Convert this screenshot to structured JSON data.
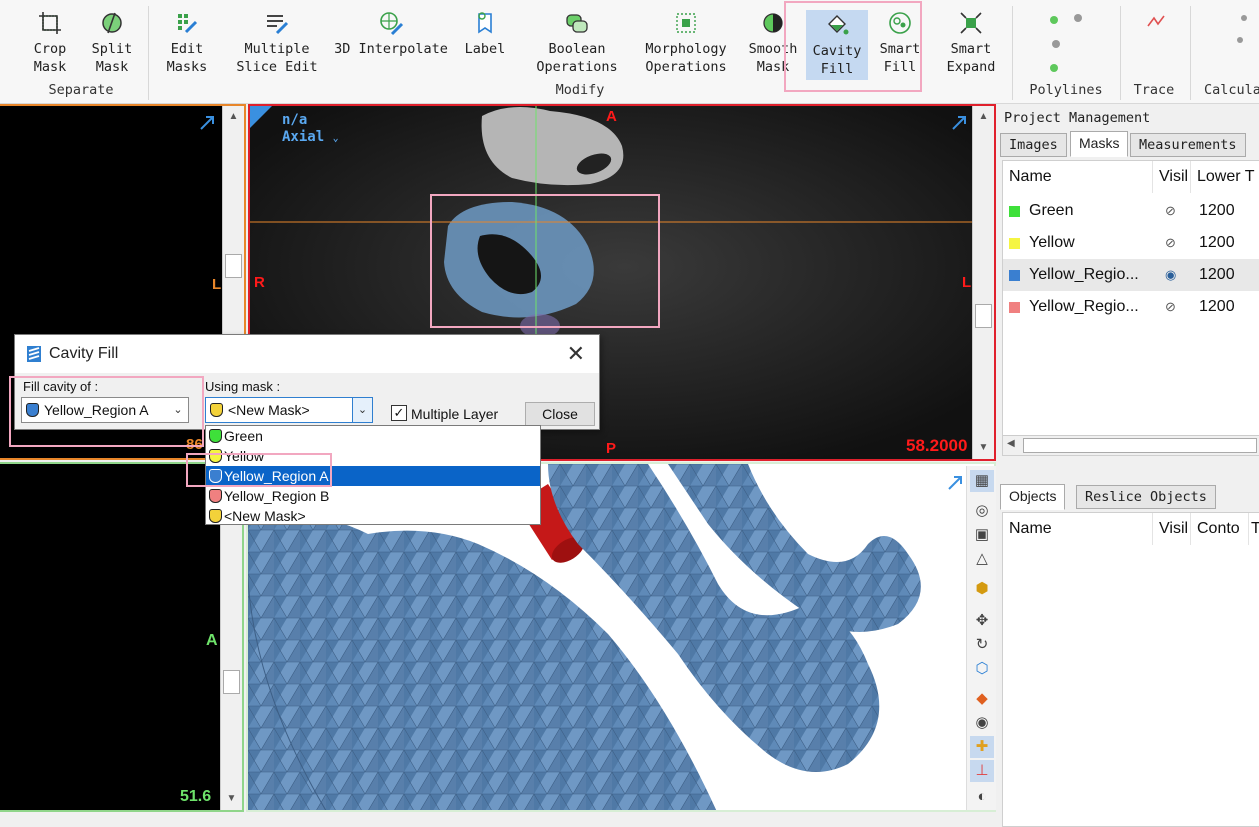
{
  "ribbon": {
    "buttons": [
      {
        "label": "Crop\nMask"
      },
      {
        "label": "Split\nMask"
      },
      {
        "label": "Edit\nMasks"
      },
      {
        "label": "Multiple\nSlice Edit"
      },
      {
        "label": "3D Interpolate"
      },
      {
        "label": "Label"
      },
      {
        "label": "Boolean\nOperations"
      },
      {
        "label": "Morphology\nOperations"
      },
      {
        "label": "Smooth\nMask"
      },
      {
        "label": "Cavity\nFill"
      },
      {
        "label": "Smart\nFill"
      },
      {
        "label": "Smart\nExpand"
      }
    ],
    "groups": {
      "separate": "Separate",
      "modify": "Modify",
      "polylines": "Polylines",
      "trace": "Trace",
      "calculate": "Calcula"
    }
  },
  "left_top": {
    "side_label": "L",
    "value": "86"
  },
  "left_bottom": {
    "side_label": "A",
    "value": "51.6"
  },
  "axial": {
    "name": "n/a",
    "orientation": "Axial",
    "top_label": "A",
    "bottom_label": "P",
    "left_label": "R",
    "right_label": "L",
    "value": "58.2000"
  },
  "dialog": {
    "title": "Cavity Fill",
    "fill_label": "Fill cavity of :",
    "fill_value": "Yellow_Region A",
    "using_label": "Using mask :",
    "using_value": "<New Mask>",
    "multiple_layer_label": "Multiple Layer",
    "multiple_layer_checked": true,
    "close_label": "Close",
    "options": [
      "Green",
      "Yellow",
      "Yellow_Region A",
      "Yellow_Region B",
      "<New Mask>"
    ],
    "selected_option": "Yellow_Region A"
  },
  "right_panel": {
    "title": "Project Management",
    "tabs": [
      "Images",
      "Masks",
      "Measurements"
    ],
    "selected_tab": "Masks",
    "columns": [
      "Name",
      "Visil",
      "Lower T"
    ],
    "masks": [
      {
        "name": "Green",
        "color": "#3ee03a",
        "visible": false,
        "lower": "1200"
      },
      {
        "name": "Yellow",
        "color": "#f5f542",
        "visible": false,
        "lower": "1200"
      },
      {
        "name": "Yellow_Regio...",
        "color": "#3a7fd0",
        "visible": true,
        "lower": "1200"
      },
      {
        "name": "Yellow_Regio...",
        "color": "#f08080",
        "visible": false,
        "lower": "1200"
      }
    ],
    "objects_tabs": [
      "Objects",
      "Reslice Objects"
    ],
    "objects_columns": [
      "Name",
      "Visil",
      "Conto",
      "T"
    ]
  }
}
